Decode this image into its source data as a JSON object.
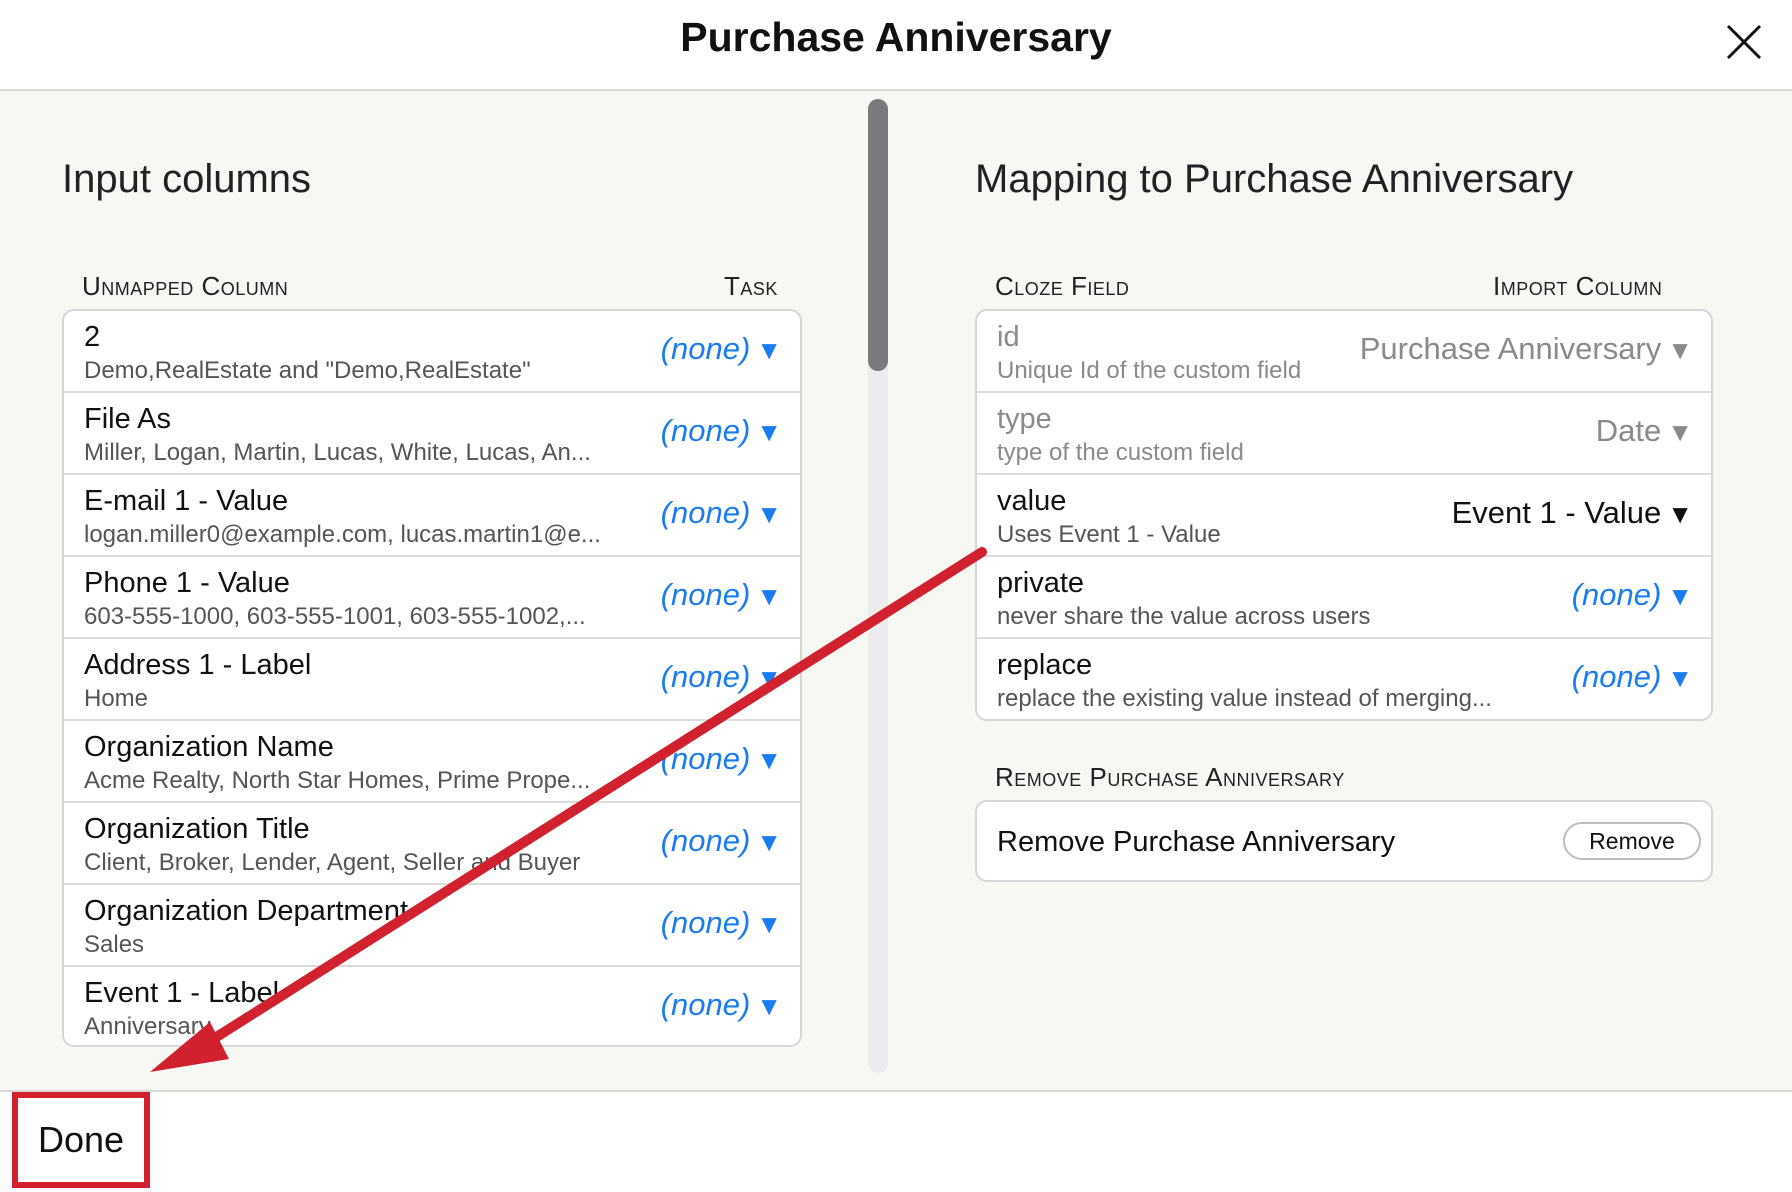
{
  "dialog": {
    "title": "Purchase Anniversary"
  },
  "left": {
    "title": "Input columns",
    "col_unmapped": "Unmapped Column",
    "col_task": "Task",
    "rows": [
      {
        "name": "2",
        "sub": "Demo,RealEstate and \"Demo,RealEstate\"",
        "task": "(none)"
      },
      {
        "name": "File As",
        "sub": "Miller, Logan, Martin, Lucas, White, Lucas, An...",
        "task": "(none)"
      },
      {
        "name": "E-mail 1 - Value",
        "sub": "logan.miller0@example.com, lucas.martin1@e...",
        "task": "(none)"
      },
      {
        "name": "Phone 1 - Value",
        "sub": "603-555-1000, 603-555-1001, 603-555-1002,...",
        "task": "(none)"
      },
      {
        "name": "Address 1 - Label",
        "sub": "Home",
        "task": "(none)"
      },
      {
        "name": "Organization Name",
        "sub": "Acme Realty, North Star Homes, Prime Prope...",
        "task": "(none)"
      },
      {
        "name": "Organization Title",
        "sub": "Client, Broker, Lender, Agent, Seller and Buyer",
        "task": "(none)"
      },
      {
        "name": "Organization Department",
        "sub": "Sales",
        "task": "(none)"
      },
      {
        "name": "Event 1 - Label",
        "sub": "Anniversary",
        "task": "(none)"
      }
    ]
  },
  "right": {
    "title": "Mapping to Purchase Anniversary",
    "col_field": "Cloze Field",
    "col_import": "Import Column",
    "rows": [
      {
        "name": "id",
        "sub": "Unique Id of the custom field",
        "task": "Purchase Anniversary"
      },
      {
        "name": "type",
        "sub": "type of the custom field",
        "task": "Date"
      },
      {
        "name": "value",
        "sub": "Uses Event 1 - Value",
        "task": "Event 1 - Value"
      },
      {
        "name": "private",
        "sub": "never share the value across users",
        "task": "(none)"
      },
      {
        "name": "replace",
        "sub": "replace the existing value instead of merging...",
        "task": "(none)"
      }
    ],
    "remove_heading": "Remove Purchase Anniversary",
    "remove_label": "Remove Purchase Anniversary",
    "remove_button": "Remove"
  },
  "footer": {
    "done_label": "Done"
  },
  "icons": {
    "close": "close-icon",
    "caret": "caret-down-icon"
  },
  "colors": {
    "accent": "#1a7cf0",
    "annotation": "#d1202e",
    "muted": "#8a8a8a"
  }
}
